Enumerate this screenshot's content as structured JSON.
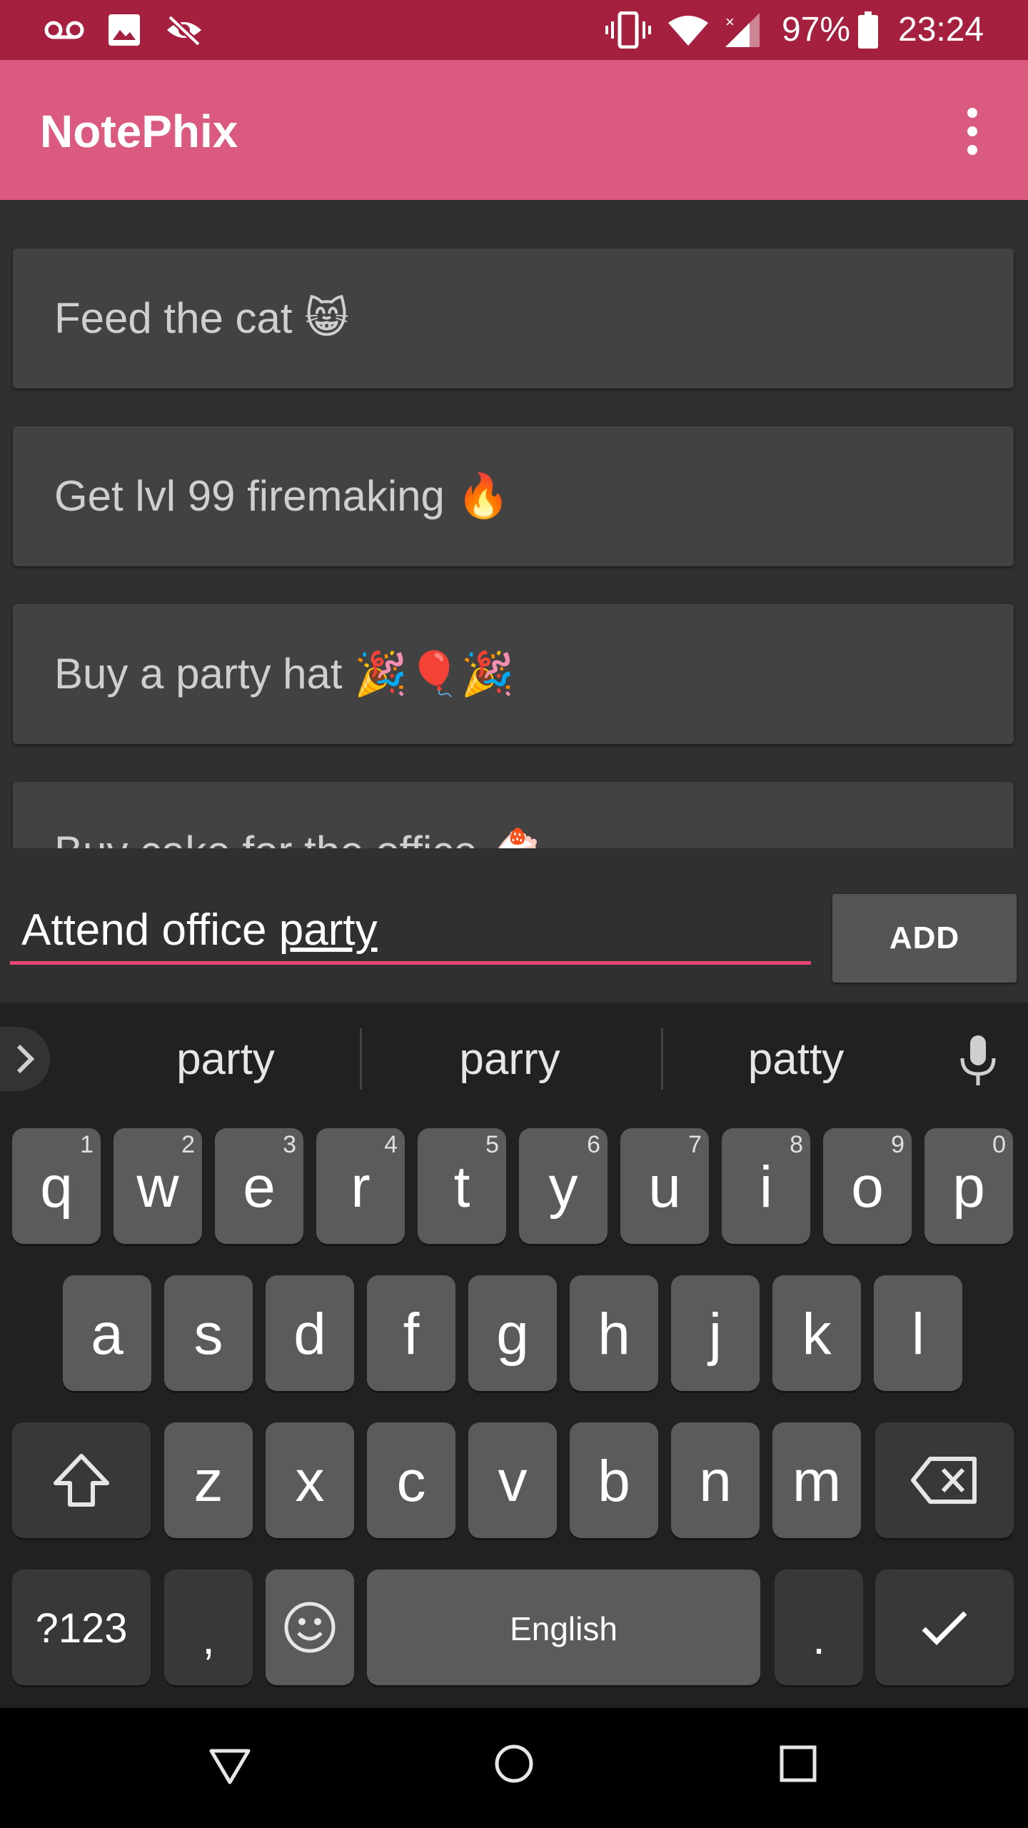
{
  "status_bar": {
    "icons": [
      "voicemail-icon",
      "image-icon",
      "eye-off-icon",
      "vibrate-icon",
      "wifi-icon",
      "signal-icon",
      "battery-icon"
    ],
    "battery": "97%",
    "time": "23:24"
  },
  "app_bar": {
    "title": "NotePhix",
    "menu_icon": "more-vert-icon"
  },
  "notes": [
    {
      "text": "Feed the cat",
      "emoji": "😸"
    },
    {
      "text": "Get lvl 99 firemaking",
      "emoji": "🔥"
    },
    {
      "text": "Buy a party hat",
      "emoji": "🎉🎈🎉"
    },
    {
      "text": "Buy cake for the office",
      "emoji": "🍰"
    }
  ],
  "input": {
    "value_prefix": "Attend office ",
    "value_composing": "party"
  },
  "add_button": {
    "label": "ADD"
  },
  "keyboard": {
    "suggestions": [
      "party",
      "parry",
      "patty"
    ],
    "row1": [
      {
        "key": "q",
        "hint": "1"
      },
      {
        "key": "w",
        "hint": "2"
      },
      {
        "key": "e",
        "hint": "3"
      },
      {
        "key": "r",
        "hint": "4"
      },
      {
        "key": "t",
        "hint": "5"
      },
      {
        "key": "y",
        "hint": "6"
      },
      {
        "key": "u",
        "hint": "7"
      },
      {
        "key": "i",
        "hint": "8"
      },
      {
        "key": "o",
        "hint": "9"
      },
      {
        "key": "p",
        "hint": "0"
      }
    ],
    "row2": [
      "a",
      "s",
      "d",
      "f",
      "g",
      "h",
      "j",
      "k",
      "l"
    ],
    "row3": [
      "z",
      "x",
      "c",
      "v",
      "b",
      "n",
      "m"
    ],
    "symbols_label": "?123",
    "comma": ",",
    "space_label": "English",
    "period": "."
  },
  "colors": {
    "status_bar": "#a51f3e",
    "app_bar": "#da5a80",
    "accent": "#e84873",
    "background": "#303030",
    "card": "#424242"
  }
}
